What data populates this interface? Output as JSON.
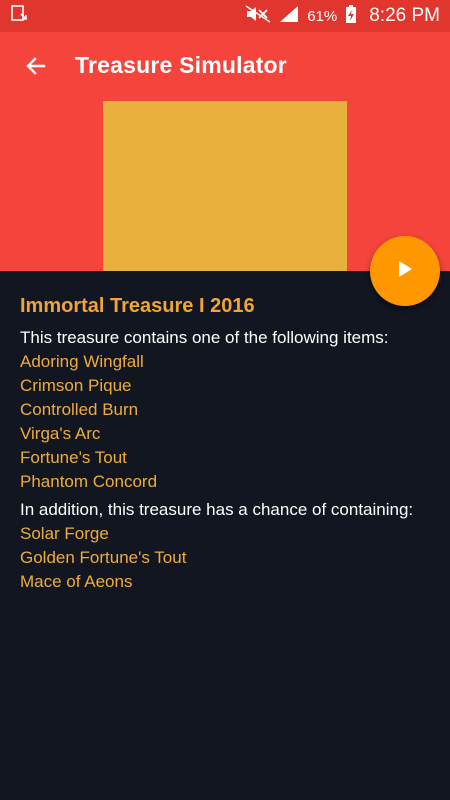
{
  "status_bar": {
    "battery_percent": "61%",
    "time": "8:26 PM",
    "icons": [
      "download-icon",
      "mute-icon",
      "signal-icon",
      "battery-charging-icon"
    ]
  },
  "app_bar": {
    "title": "Treasure Simulator",
    "back_icon": "arrow-left-icon",
    "color": "#f4443b"
  },
  "treasure_image": {
    "color": "#e8b13e"
  },
  "fab": {
    "icon": "play-icon",
    "color": "#ff9800"
  },
  "treasure": {
    "name": "Immortal Treasure I 2016",
    "contains_label": "This treasure contains one of the following items:",
    "items": [
      "Adoring Wingfall",
      "Crimson Pique",
      "Controlled Burn",
      "Virga's Arc",
      "Fortune's Tout",
      "Phantom Concord"
    ],
    "bonus_label": "In addition, this treasure has a chance of containing:",
    "bonus_items": [
      "Solar Forge",
      "Golden Fortune's Tout",
      "Mace of Aeons"
    ]
  }
}
